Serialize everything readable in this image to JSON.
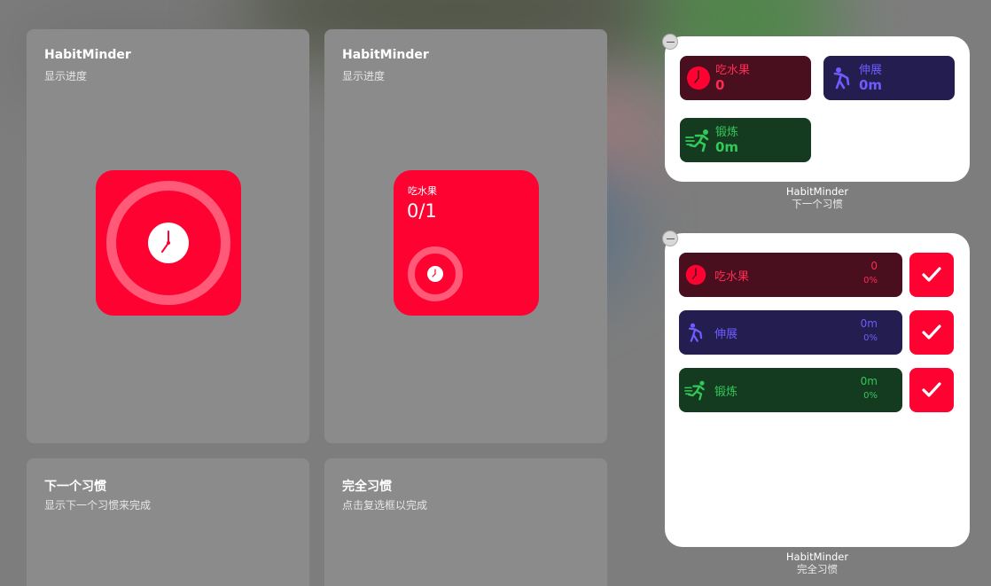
{
  "colors": {
    "accent_red": "#fe0232",
    "blue": "#6f5bff",
    "green": "#34c759"
  },
  "gallery": {
    "panel1": {
      "title": "HabitMinder",
      "subtitle": "显示进度"
    },
    "panel2": {
      "title": "HabitMinder",
      "subtitle": "显示进度",
      "habit_name": "吃水果",
      "progress": "0/1"
    },
    "panel3": {
      "title": "下一个习惯",
      "subtitle": "显示下一个习惯来完成"
    },
    "panel4": {
      "title": "完全习惯",
      "subtitle": "点击复选框以完成"
    }
  },
  "widget_next": {
    "label_app": "HabitMinder",
    "label_kind": "下一个习惯",
    "tiles": [
      {
        "name": "吃水果",
        "value": "0",
        "icon": "clock-icon",
        "color": "red"
      },
      {
        "name": "伸展",
        "value": "0m",
        "icon": "stretch-icon",
        "color": "blue"
      },
      {
        "name": "锻炼",
        "value": "0m",
        "icon": "running-icon",
        "color": "green"
      }
    ]
  },
  "widget_complete": {
    "label_app": "HabitMinder",
    "label_kind": "完全习惯",
    "rows": [
      {
        "name": "吃水果",
        "value": "0",
        "percent": "0%",
        "icon": "clock-icon",
        "color": "red"
      },
      {
        "name": "伸展",
        "value": "0m",
        "percent": "0%",
        "icon": "stretch-icon",
        "color": "blue"
      },
      {
        "name": "锻炼",
        "value": "0m",
        "percent": "0%",
        "icon": "running-icon",
        "color": "green"
      }
    ]
  }
}
